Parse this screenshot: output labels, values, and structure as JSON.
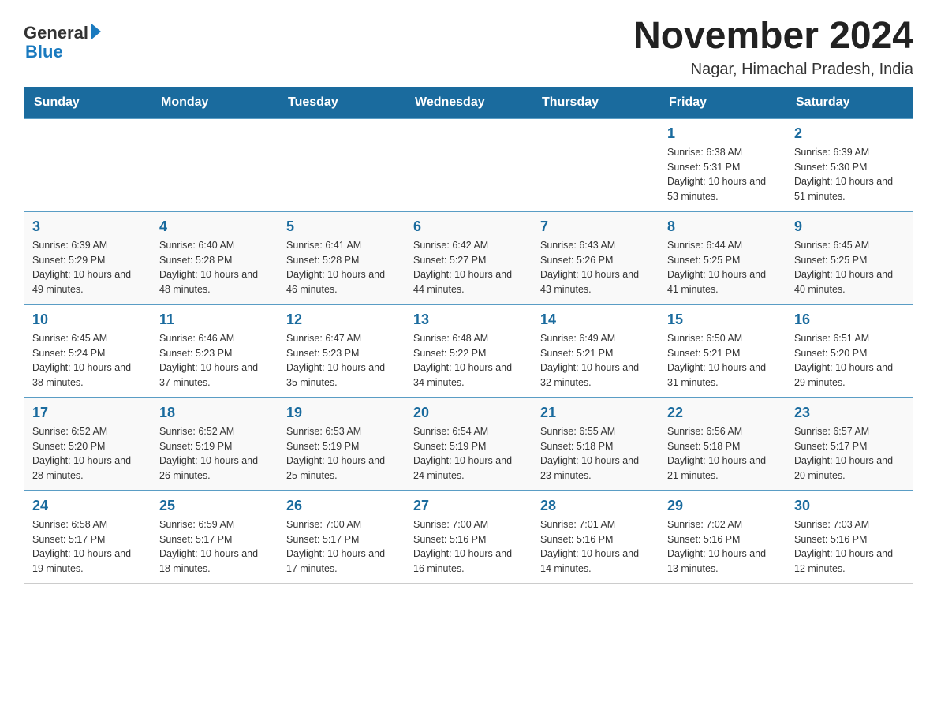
{
  "header": {
    "logo_text_general": "General",
    "logo_text_blue": "Blue",
    "title": "November 2024",
    "subtitle": "Nagar, Himachal Pradesh, India"
  },
  "weekdays": [
    "Sunday",
    "Monday",
    "Tuesday",
    "Wednesday",
    "Thursday",
    "Friday",
    "Saturday"
  ],
  "weeks": [
    {
      "days": [
        {
          "number": "",
          "info": ""
        },
        {
          "number": "",
          "info": ""
        },
        {
          "number": "",
          "info": ""
        },
        {
          "number": "",
          "info": ""
        },
        {
          "number": "",
          "info": ""
        },
        {
          "number": "1",
          "info": "Sunrise: 6:38 AM\nSunset: 5:31 PM\nDaylight: 10 hours and 53 minutes."
        },
        {
          "number": "2",
          "info": "Sunrise: 6:39 AM\nSunset: 5:30 PM\nDaylight: 10 hours and 51 minutes."
        }
      ]
    },
    {
      "days": [
        {
          "number": "3",
          "info": "Sunrise: 6:39 AM\nSunset: 5:29 PM\nDaylight: 10 hours and 49 minutes."
        },
        {
          "number": "4",
          "info": "Sunrise: 6:40 AM\nSunset: 5:28 PM\nDaylight: 10 hours and 48 minutes."
        },
        {
          "number": "5",
          "info": "Sunrise: 6:41 AM\nSunset: 5:28 PM\nDaylight: 10 hours and 46 minutes."
        },
        {
          "number": "6",
          "info": "Sunrise: 6:42 AM\nSunset: 5:27 PM\nDaylight: 10 hours and 44 minutes."
        },
        {
          "number": "7",
          "info": "Sunrise: 6:43 AM\nSunset: 5:26 PM\nDaylight: 10 hours and 43 minutes."
        },
        {
          "number": "8",
          "info": "Sunrise: 6:44 AM\nSunset: 5:25 PM\nDaylight: 10 hours and 41 minutes."
        },
        {
          "number": "9",
          "info": "Sunrise: 6:45 AM\nSunset: 5:25 PM\nDaylight: 10 hours and 40 minutes."
        }
      ]
    },
    {
      "days": [
        {
          "number": "10",
          "info": "Sunrise: 6:45 AM\nSunset: 5:24 PM\nDaylight: 10 hours and 38 minutes."
        },
        {
          "number": "11",
          "info": "Sunrise: 6:46 AM\nSunset: 5:23 PM\nDaylight: 10 hours and 37 minutes."
        },
        {
          "number": "12",
          "info": "Sunrise: 6:47 AM\nSunset: 5:23 PM\nDaylight: 10 hours and 35 minutes."
        },
        {
          "number": "13",
          "info": "Sunrise: 6:48 AM\nSunset: 5:22 PM\nDaylight: 10 hours and 34 minutes."
        },
        {
          "number": "14",
          "info": "Sunrise: 6:49 AM\nSunset: 5:21 PM\nDaylight: 10 hours and 32 minutes."
        },
        {
          "number": "15",
          "info": "Sunrise: 6:50 AM\nSunset: 5:21 PM\nDaylight: 10 hours and 31 minutes."
        },
        {
          "number": "16",
          "info": "Sunrise: 6:51 AM\nSunset: 5:20 PM\nDaylight: 10 hours and 29 minutes."
        }
      ]
    },
    {
      "days": [
        {
          "number": "17",
          "info": "Sunrise: 6:52 AM\nSunset: 5:20 PM\nDaylight: 10 hours and 28 minutes."
        },
        {
          "number": "18",
          "info": "Sunrise: 6:52 AM\nSunset: 5:19 PM\nDaylight: 10 hours and 26 minutes."
        },
        {
          "number": "19",
          "info": "Sunrise: 6:53 AM\nSunset: 5:19 PM\nDaylight: 10 hours and 25 minutes."
        },
        {
          "number": "20",
          "info": "Sunrise: 6:54 AM\nSunset: 5:19 PM\nDaylight: 10 hours and 24 minutes."
        },
        {
          "number": "21",
          "info": "Sunrise: 6:55 AM\nSunset: 5:18 PM\nDaylight: 10 hours and 23 minutes."
        },
        {
          "number": "22",
          "info": "Sunrise: 6:56 AM\nSunset: 5:18 PM\nDaylight: 10 hours and 21 minutes."
        },
        {
          "number": "23",
          "info": "Sunrise: 6:57 AM\nSunset: 5:17 PM\nDaylight: 10 hours and 20 minutes."
        }
      ]
    },
    {
      "days": [
        {
          "number": "24",
          "info": "Sunrise: 6:58 AM\nSunset: 5:17 PM\nDaylight: 10 hours and 19 minutes."
        },
        {
          "number": "25",
          "info": "Sunrise: 6:59 AM\nSunset: 5:17 PM\nDaylight: 10 hours and 18 minutes."
        },
        {
          "number": "26",
          "info": "Sunrise: 7:00 AM\nSunset: 5:17 PM\nDaylight: 10 hours and 17 minutes."
        },
        {
          "number": "27",
          "info": "Sunrise: 7:00 AM\nSunset: 5:16 PM\nDaylight: 10 hours and 16 minutes."
        },
        {
          "number": "28",
          "info": "Sunrise: 7:01 AM\nSunset: 5:16 PM\nDaylight: 10 hours and 14 minutes."
        },
        {
          "number": "29",
          "info": "Sunrise: 7:02 AM\nSunset: 5:16 PM\nDaylight: 10 hours and 13 minutes."
        },
        {
          "number": "30",
          "info": "Sunrise: 7:03 AM\nSunset: 5:16 PM\nDaylight: 10 hours and 12 minutes."
        }
      ]
    }
  ]
}
